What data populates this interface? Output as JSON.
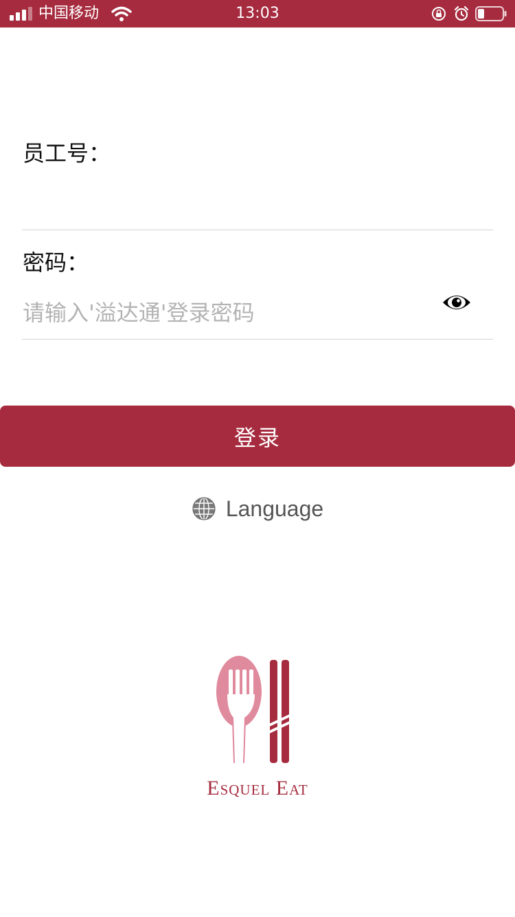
{
  "status_bar": {
    "carrier": "中国移动",
    "time": "13:03",
    "background": "#a62b3e",
    "icons": [
      "signal-icon",
      "wifi-icon",
      "rotation-lock-icon",
      "alarm-icon",
      "battery-icon"
    ]
  },
  "form": {
    "employee_label": "员工号：",
    "employee_value": "",
    "employee_placeholder": "",
    "password_label": "密码：",
    "password_value": "",
    "password_placeholder": "请输入'溢达通'登录密码"
  },
  "login_button": {
    "label": "登录",
    "color": "#a62b3e"
  },
  "language": {
    "label": "Language",
    "icon": "globe-icon"
  },
  "brand": {
    "name": "Esquel Eat",
    "colors": {
      "spoon": "#e08a9e",
      "chopsticks": "#a62b3e"
    }
  }
}
